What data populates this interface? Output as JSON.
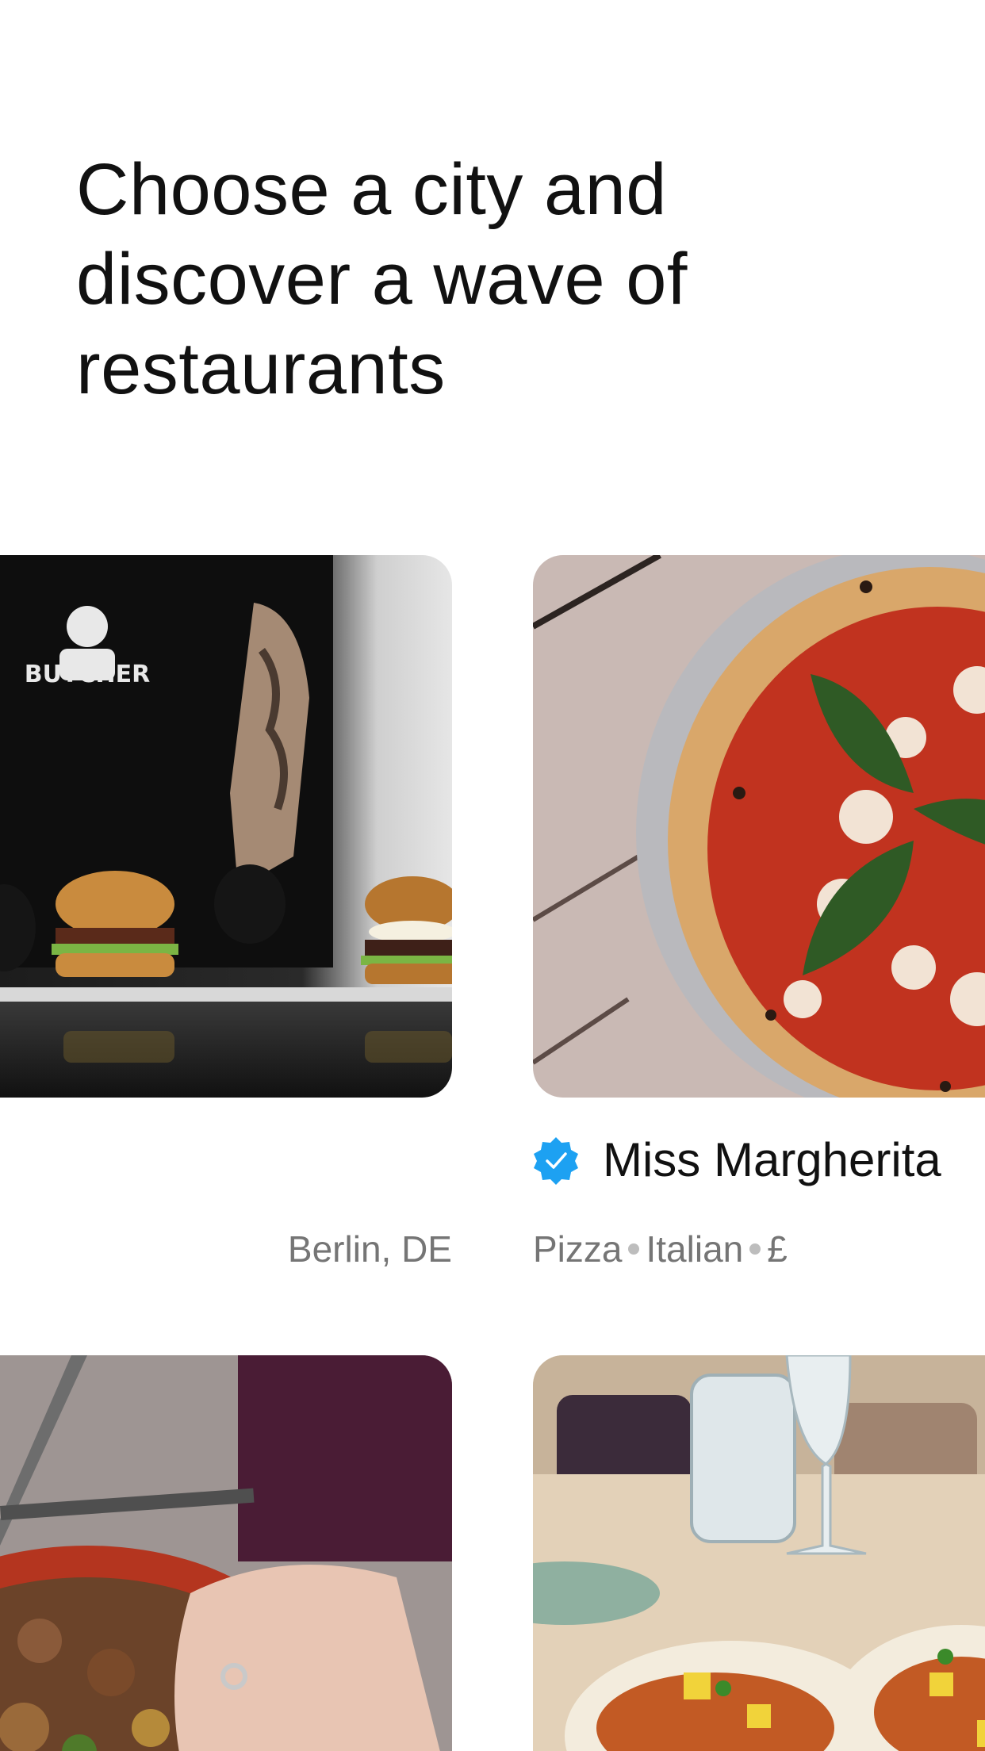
{
  "header": {
    "title_lines": [
      "Choose a city and",
      "discover a wave of",
      "restaurants"
    ]
  },
  "cards": [
    {
      "image_label": "burger-photo",
      "location": "Berlin, DE"
    },
    {
      "image_label": "pizza-photo",
      "name": "Miss Margherita",
      "verified_icon": "verified-badge-icon",
      "tags": [
        "Pizza",
        "Italian",
        "£"
      ]
    },
    {
      "image_label": "meat-stew-photo"
    },
    {
      "image_label": "tacos-photo"
    }
  ],
  "colors": {
    "accent": "#1da1f2",
    "text": "#111111",
    "meta_text": "#757575",
    "dot": "#bdbdbd"
  }
}
